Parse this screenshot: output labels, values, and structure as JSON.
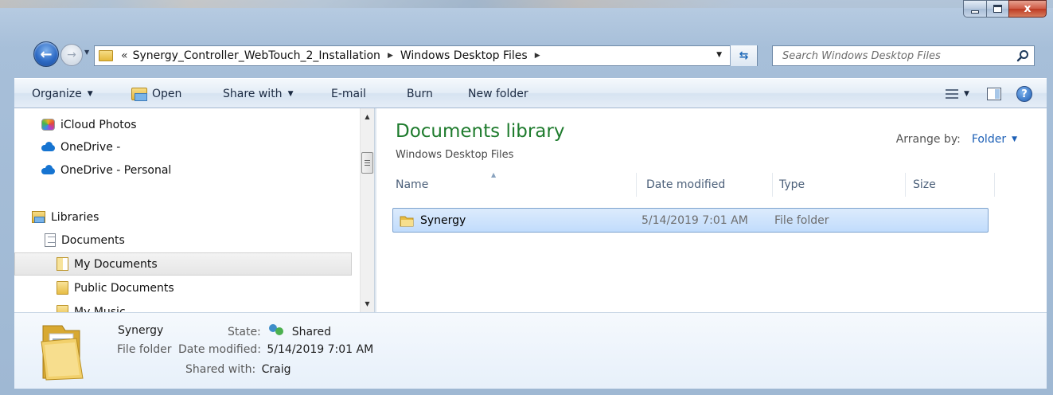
{
  "window": {
    "controls": {
      "minimize": "",
      "maximize": "",
      "close": "x"
    }
  },
  "nav": {
    "back_glyph": "←",
    "forward_glyph": "→",
    "recent_glyph": "▼",
    "breadcrumb_prefix": "«",
    "breadcrumbs": [
      "Synergy_Controller_WebTouch_2_Installation",
      "Windows Desktop Files"
    ],
    "separator_glyph": "▶",
    "dropdown_glyph": "▼",
    "refresh_glyph": "⇆"
  },
  "search": {
    "placeholder": "Search Windows Desktop Files",
    "value": ""
  },
  "toolbar": {
    "organize": "Organize",
    "open": "Open",
    "share_with": "Share with",
    "email": "E-mail",
    "burn": "Burn",
    "new_folder": "New folder",
    "dropdown_glyph": "▼",
    "help_glyph": "?"
  },
  "sidebar": {
    "items": [
      {
        "label": "iCloud Photos",
        "icon": "icloud-photos-icon"
      },
      {
        "label": "OneDrive -",
        "icon": "onedrive-icon"
      },
      {
        "label": "OneDrive - Personal",
        "icon": "onedrive-icon"
      },
      {
        "label": "Libraries",
        "icon": "libraries-icon"
      },
      {
        "label": "Documents",
        "icon": "document-icon"
      },
      {
        "label": "My Documents",
        "icon": "folder-icon",
        "selected": true
      },
      {
        "label": "Public Documents",
        "icon": "folder-icon"
      },
      {
        "label": "My Music",
        "icon": "folder-icon"
      }
    ],
    "scroll_up_glyph": "▲",
    "scroll_down_glyph": "▼"
  },
  "main": {
    "title": "Documents library",
    "subtitle": "Windows Desktop Files",
    "arrange_label": "Arrange by:",
    "arrange_value": "Folder",
    "arrange_glyph": "▼",
    "sort_glyph": "▲",
    "columns": [
      "Name",
      "Date modified",
      "Type",
      "Size"
    ],
    "rows": [
      {
        "name": "Synergy",
        "date_modified": "5/14/2019 7:01 AM",
        "type": "File folder",
        "size": ""
      }
    ]
  },
  "details": {
    "name": "Synergy",
    "kind": "File folder",
    "state_label": "State:",
    "state_value": "Shared",
    "date_label": "Date modified:",
    "date_value": "5/14/2019 7:01 AM",
    "shared_label": "Shared with:",
    "shared_value": "Craig"
  },
  "colors": {
    "library_title": "#1e7b2d",
    "link_blue": "#1c5fb6",
    "selection": "#cde4fc"
  }
}
